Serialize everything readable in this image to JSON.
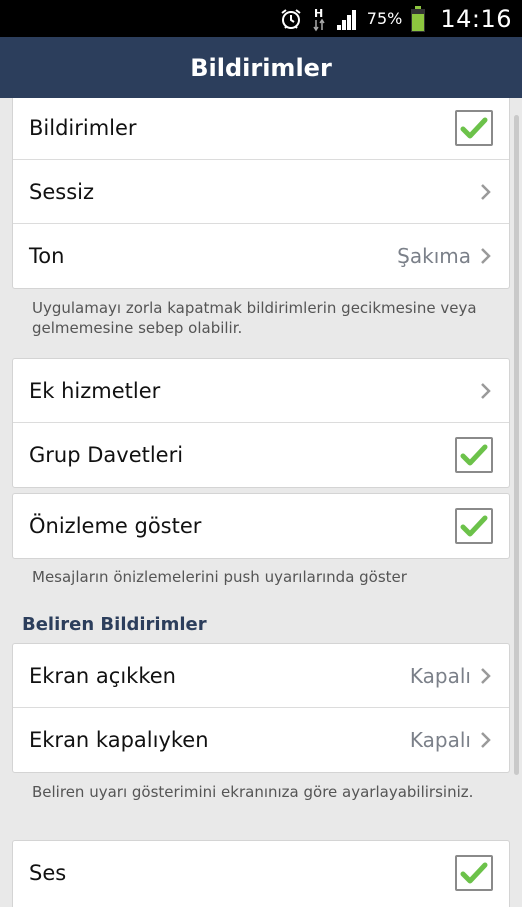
{
  "status_bar": {
    "alarm_icon": "alarm-clock-icon",
    "network_icon": "hspa-network-icon",
    "signal_icon": "signal-bars-icon",
    "battery_percent": "75%",
    "battery_icon": "battery-icon",
    "battery_color": "#8dc63f",
    "time": "14:16"
  },
  "header": {
    "title": "Bildirimler",
    "color": "#2c3e5c"
  },
  "group1": {
    "rows": [
      {
        "label": "Bildirimler",
        "checked": true
      },
      {
        "label": "Sessiz"
      },
      {
        "label": "Ton",
        "value": "Şakıma"
      }
    ],
    "note": "Uygulamayı zorla kapatmak bildirimlerin gecikmesine veya gelmemesine sebep olabilir."
  },
  "group2": {
    "rows": [
      {
        "label": "Ek hizmetler"
      },
      {
        "label": "Grup Davetleri",
        "checked": true
      }
    ]
  },
  "group3": {
    "rows": [
      {
        "label": "Önizleme göster",
        "checked": true
      }
    ],
    "note": "Mesajların önizlemelerini push uyarılarında göster"
  },
  "popup_section": {
    "title": "Beliren Bildirimler",
    "rows": [
      {
        "label": "Ekran açıkken",
        "value": "Kapalı"
      },
      {
        "label": "Ekran kapalıyken",
        "value": "Kapalı"
      }
    ],
    "note": "Beliren uyarı gösterimini ekranınıza göre ayarlayabilirsiniz."
  },
  "group5": {
    "rows": [
      {
        "label": "Ses",
        "checked": true
      }
    ]
  },
  "colors": {
    "check_green": "#6cc24a",
    "chevron": "#9a9a9a"
  }
}
